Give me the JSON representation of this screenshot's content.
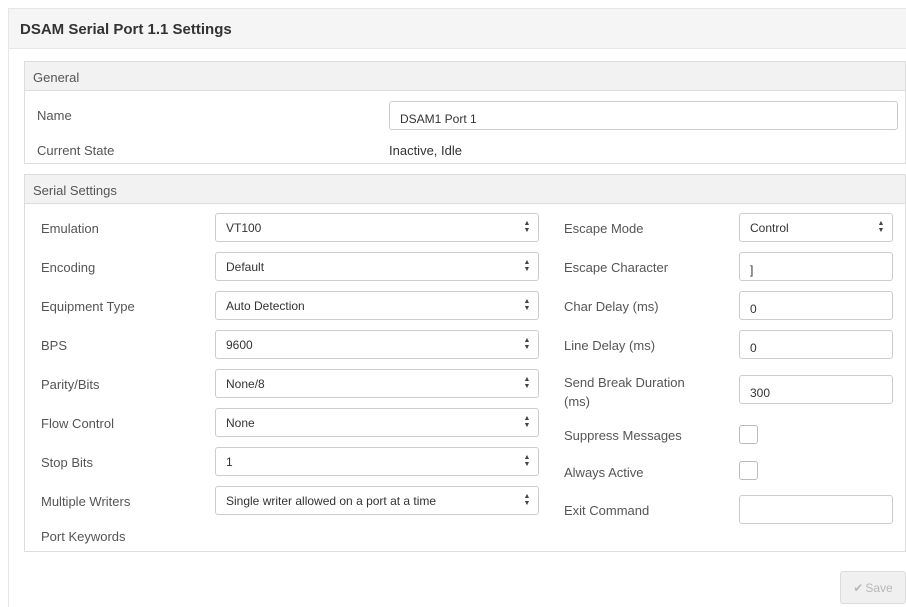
{
  "page": {
    "title": "DSAM Serial Port 1.1 Settings"
  },
  "general": {
    "heading": "General",
    "name_label": "Name",
    "name_value": "DSAM1 Port 1",
    "state_label": "Current State",
    "state_value": "Inactive, Idle"
  },
  "serial": {
    "heading": "Serial Settings",
    "emulation": {
      "label": "Emulation",
      "value": "VT100"
    },
    "encoding": {
      "label": "Encoding",
      "value": "Default"
    },
    "equipment_type": {
      "label": "Equipment Type",
      "value": "Auto Detection"
    },
    "bps": {
      "label": "BPS",
      "value": "9600"
    },
    "parity_bits": {
      "label": "Parity/Bits",
      "value": "None/8"
    },
    "flow_control": {
      "label": "Flow Control",
      "value": "None"
    },
    "stop_bits": {
      "label": "Stop Bits",
      "value": "1"
    },
    "multiple_writers": {
      "label": "Multiple Writers",
      "value": "Single writer allowed on a port at a time"
    },
    "port_keywords": {
      "label": "Port Keywords"
    },
    "escape_mode": {
      "label": "Escape Mode",
      "value": "Control"
    },
    "escape_character": {
      "label": "Escape Character",
      "value": "]"
    },
    "char_delay": {
      "label": "Char Delay (ms)",
      "value": "0"
    },
    "line_delay": {
      "label": "Line Delay (ms)",
      "value": "0"
    },
    "send_break": {
      "label_line1": "Send Break Duration",
      "label_line2": "(ms)",
      "value": "300"
    },
    "suppress_messages": {
      "label": "Suppress Messages",
      "checked": false
    },
    "always_active": {
      "label": "Always Active",
      "checked": false
    },
    "exit_command": {
      "label": "Exit Command",
      "value": ""
    }
  },
  "footer": {
    "save_label": "Save",
    "save_icon": "checkmark-icon"
  },
  "colors": {
    "border": "#dddddd",
    "heading_bg": "#f2f2f2",
    "text": "#555555"
  }
}
